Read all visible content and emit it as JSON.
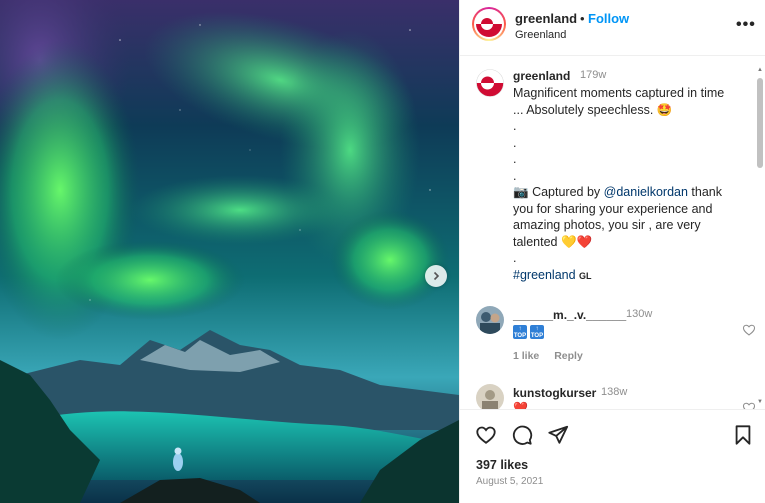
{
  "header": {
    "username": "greenland",
    "separator": "•",
    "follow_label": "Follow",
    "location": "Greenland",
    "more_label": "•••"
  },
  "caption": {
    "username": "greenland",
    "time": "179w",
    "line1": "Magnificent moments captured in time",
    "line2": "... Absolutely speechless. 🤩",
    "dots": [
      ".",
      ".",
      ".",
      "."
    ],
    "camera_emoji": "📷",
    "captured_prefix": "Captured by",
    "mention": "@danielkordan",
    "captured_suffix": "thank",
    "line_b": "you for sharing your experience and",
    "line_c": "amazing photos, you sir , are very",
    "line_d_text": "talented",
    "line_d_emoji_a": "💛",
    "line_d_emoji_b": "❤️",
    "final_dot": ".",
    "hashtag": "#greenland",
    "hashtag_suffix": "GL"
  },
  "comments": [
    {
      "username": "______m._.v.______",
      "time": "130w",
      "badges": [
        "↑ TOP",
        "↑ TOP"
      ],
      "likes": "1 like",
      "reply": "Reply"
    },
    {
      "username": "kunstogkurser",
      "time": "138w",
      "emoji": "❤️"
    }
  ],
  "footer": {
    "likes": "397 likes",
    "date": "August 5, 2021"
  },
  "colors": {
    "link": "#0095f6",
    "mention": "#00376b",
    "aurora": "#38e07a",
    "sky": "#0b3a5a"
  },
  "icons": {
    "like": "heart-icon",
    "comment": "comment-icon",
    "share": "send-icon",
    "save": "bookmark-icon",
    "next": "chevron-right-icon",
    "more": "more-icon"
  }
}
